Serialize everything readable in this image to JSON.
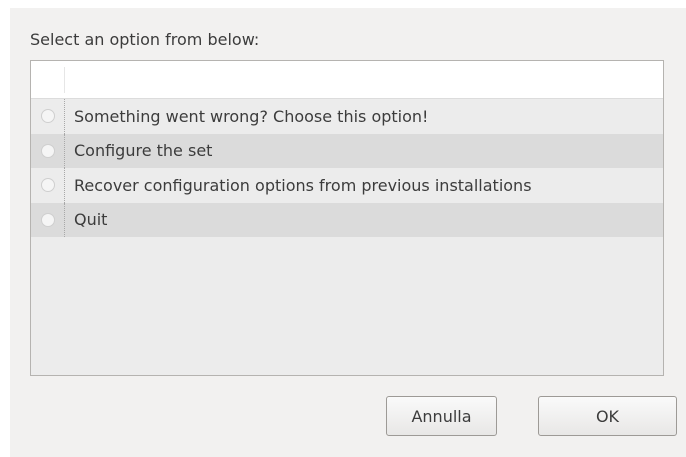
{
  "dialog": {
    "prompt": "Select an option from below:",
    "options": [
      {
        "label": "Something went wrong? Choose this option!",
        "selected": false
      },
      {
        "label": "Configure the set",
        "selected": false
      },
      {
        "label": "Recover configuration options from previous installations",
        "selected": false
      },
      {
        "label": "Quit",
        "selected": false
      }
    ],
    "buttons": {
      "cancel_label": "Annulla",
      "ok_label": "OK"
    }
  },
  "colors": {
    "dialog_bg": "#f2f1f0",
    "row_alt_bg": "#dbdbdb",
    "text": "#3c3c3c"
  },
  "icons": {
    "radio": "radio-unchecked-icon"
  }
}
